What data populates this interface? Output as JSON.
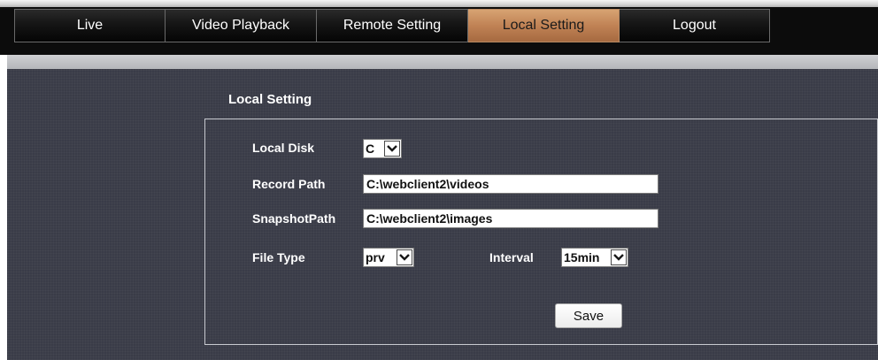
{
  "nav": {
    "tabs": [
      {
        "label": "Live",
        "active": false
      },
      {
        "label": "Video Playback",
        "active": false
      },
      {
        "label": "Remote Setting",
        "active": false
      },
      {
        "label": "Local Setting",
        "active": true
      },
      {
        "label": "Logout",
        "active": false
      }
    ]
  },
  "colors": {
    "nav_background": "#0c0c0c",
    "active_tab": "#c08255",
    "content_background": "#3a3c48",
    "text": "#ffffff"
  },
  "section": {
    "title": "Local Setting"
  },
  "form": {
    "local_disk": {
      "label": "Local Disk",
      "value": "C"
    },
    "record_path": {
      "label": "Record Path",
      "value": "C:\\webclient2\\videos"
    },
    "snapshot_path": {
      "label": "SnapshotPath",
      "value": "C:\\webclient2\\images"
    },
    "file_type": {
      "label": "File Type",
      "value": "prv"
    },
    "interval": {
      "label": "Interval",
      "value": "15min"
    },
    "save_label": "Save"
  },
  "icons": {
    "dropdown_arrow": "chevron-down-icon"
  }
}
